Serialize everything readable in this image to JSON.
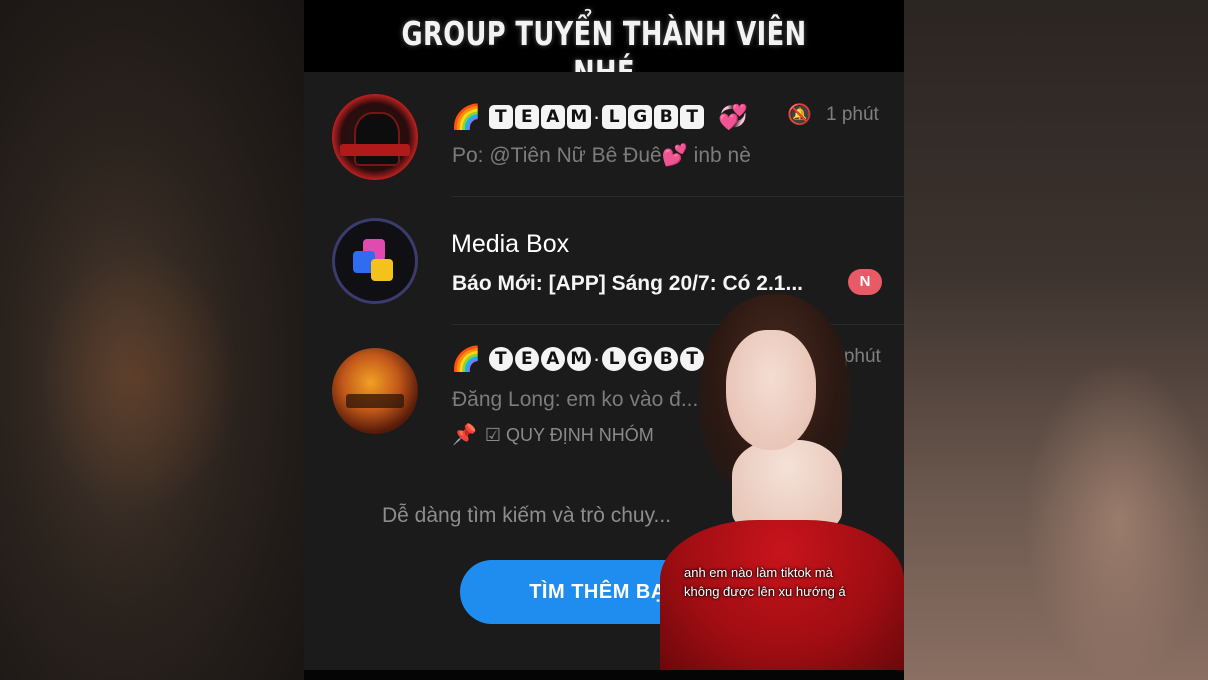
{
  "caption": "GROUP TUYỂN THÀNH VIÊN NHÉ",
  "chats": [
    {
      "title_emoji": "🌈",
      "title_letters_1": [
        "T",
        "E",
        "A",
        "M"
      ],
      "title_letters_2": [
        "L",
        "G",
        "B",
        "T"
      ],
      "title_suffix": "💞",
      "time": "1 phút",
      "preview": "Po: @Tiên Nữ Bê Đuê💕 inb nè"
    },
    {
      "title": "Media Box",
      "preview": "Báo Mới: [APP] Sáng 20/7: Có 2.1...",
      "badge": "N"
    },
    {
      "title_emoji": "🌈",
      "title_letters_1": [
        "T",
        "E",
        "A",
        "M"
      ],
      "title_letters_2": [
        "L",
        "G",
        "B",
        "T"
      ],
      "title_suffix": "✦",
      "time": "2 phút",
      "preview": "Đăng Long: em ko vào đ...",
      "pinned": "☑ QUY ĐỊNH NHÓM"
    }
  ],
  "empty_state": {
    "text": "Dễ dàng tìm kiếm và trò chuy...",
    "button": "TÌM THÊM BẠN"
  },
  "overlay_subtitle": {
    "line1": "anh em nào làm tiktok mà",
    "line2": "không được lên xu hướng á"
  },
  "icons": {
    "muted": "bell-off-icon",
    "pin": "pin-icon"
  },
  "colors": {
    "accent_button": "#1f8df0",
    "badge": "#e85a66",
    "background": "#1b1b1b"
  }
}
